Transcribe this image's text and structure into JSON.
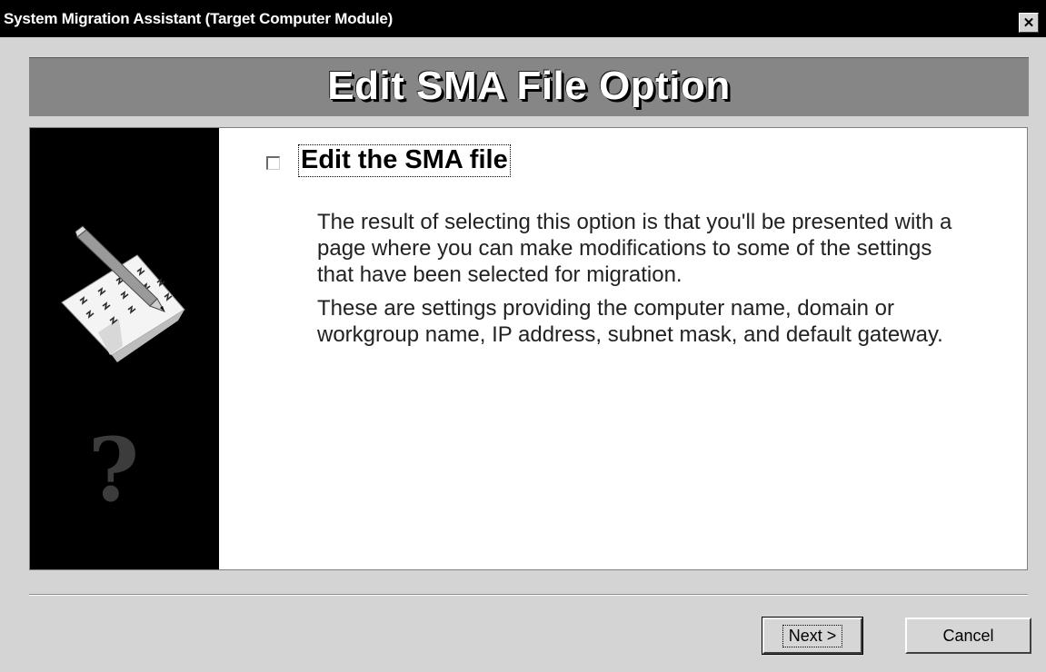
{
  "window": {
    "title": "System Migration Assistant (Target Computer Module)",
    "close_glyph": "✕"
  },
  "banner": {
    "title": "Edit SMA File Option"
  },
  "option": {
    "checked": false,
    "label": "Edit the SMA file",
    "description": [
      "The result of selecting this option is that you'll be presented with a page where you can make modifications to some of the settings that have been selected for migration.",
      "These are settings providing the computer name, domain or workgroup name, IP address, subnet mask, and default gateway."
    ]
  },
  "sidebar": {
    "illustration_icon": "notepad-pencil-icon",
    "help_icon": "question-mark-icon",
    "help_glyph": "?"
  },
  "buttons": {
    "next_label": "Next >",
    "cancel_label": "Cancel"
  },
  "colors": {
    "titlebar": "#000000",
    "banner": "#868686",
    "sidebar": "#000000",
    "dialog": "#d4d4d4"
  }
}
